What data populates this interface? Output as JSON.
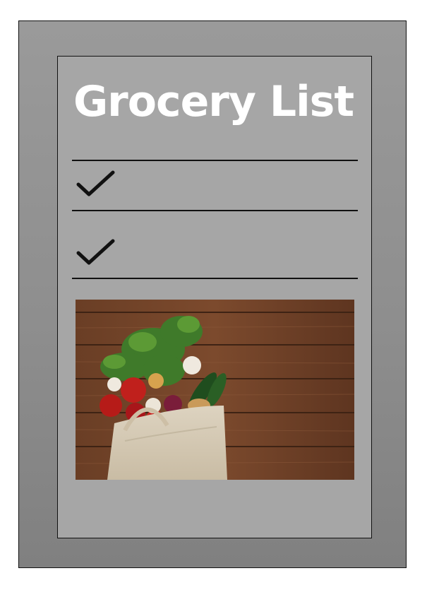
{
  "title": "Grocery List",
  "checklist": {
    "items": [
      {
        "checked": true,
        "icon": "checkmark-icon"
      },
      {
        "checked": true,
        "icon": "checkmark-icon"
      }
    ]
  },
  "photo": {
    "icon": "groceries-bag-photo"
  },
  "colors": {
    "frame": "#8e8e8e",
    "card": "#a6a6a6",
    "title_text": "#ffffff",
    "lines": "#111111",
    "wood": "#6b3f26"
  }
}
